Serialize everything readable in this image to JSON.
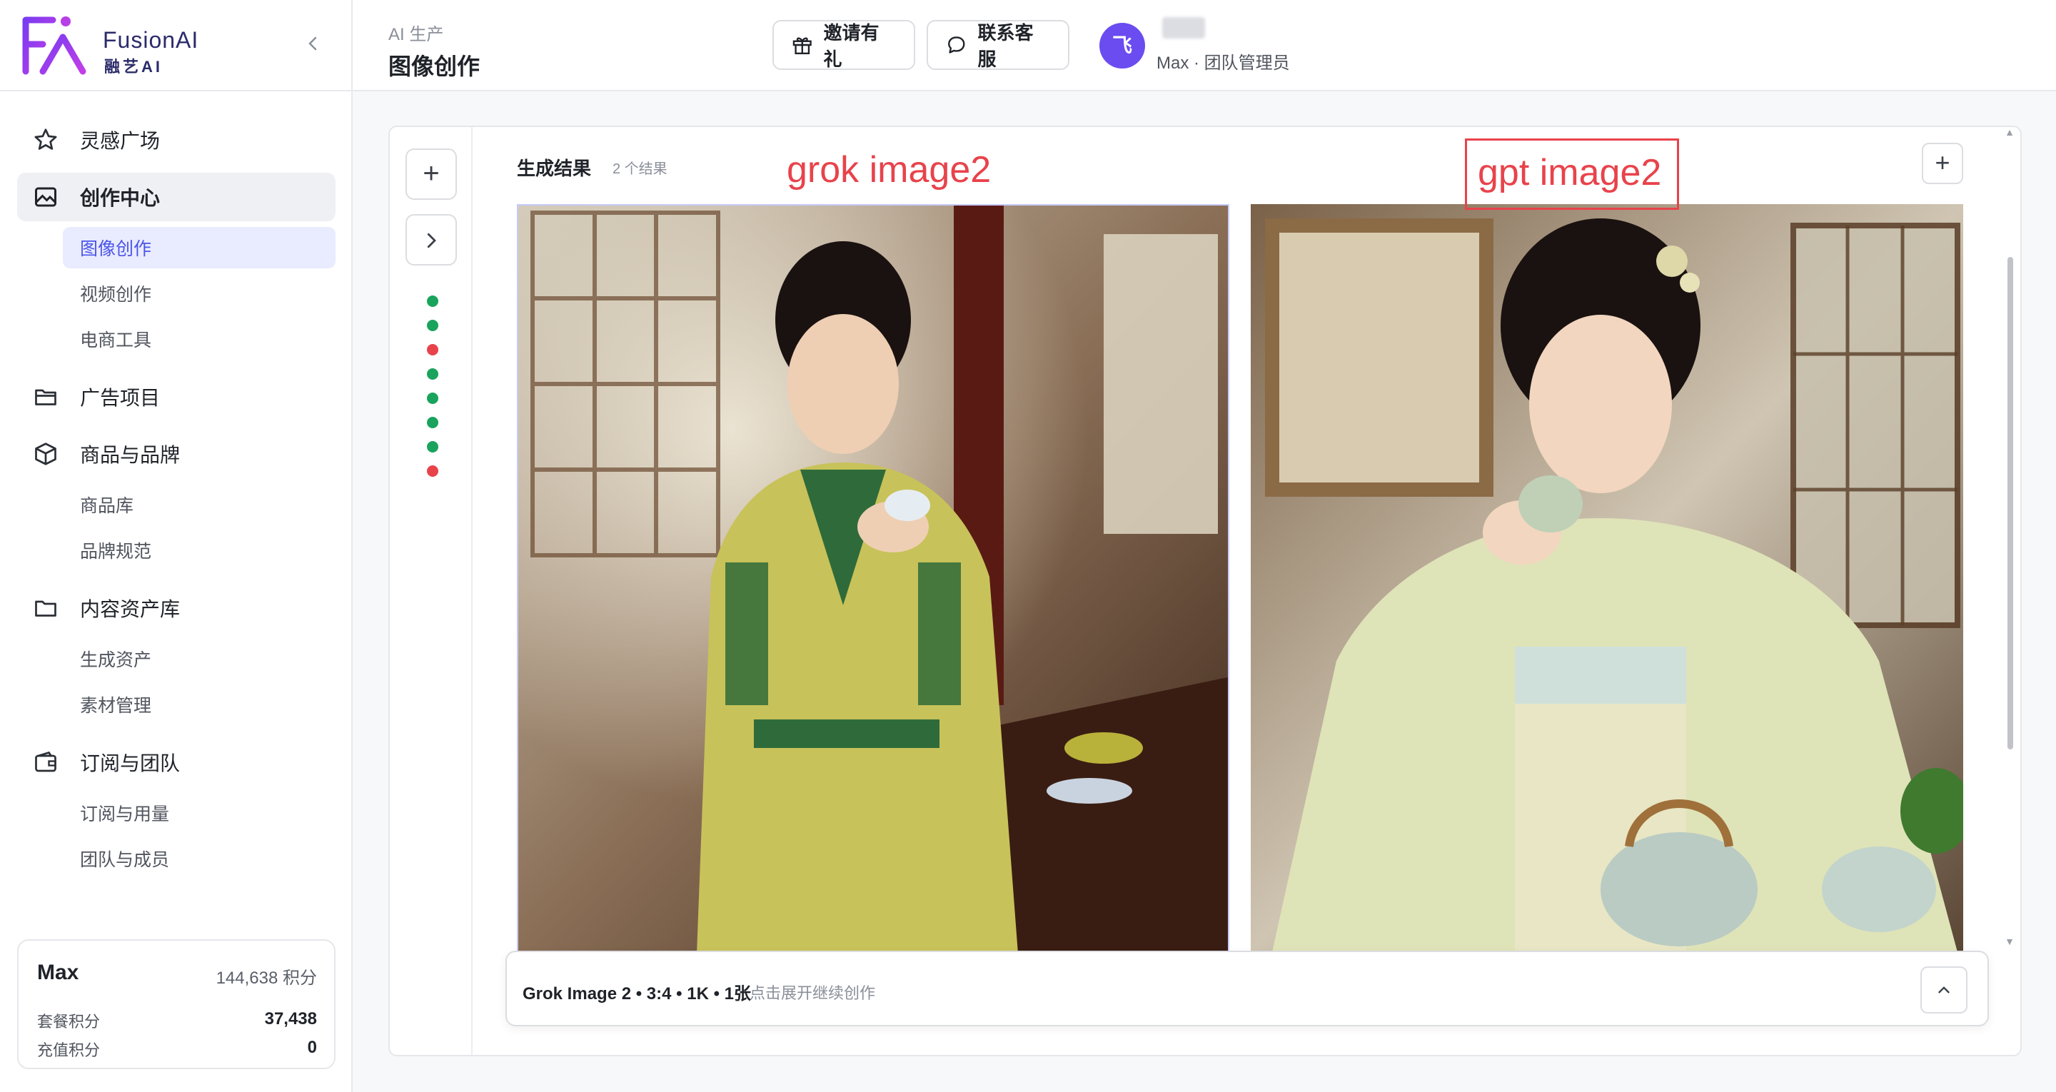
{
  "brand": {
    "name": "FusionAI",
    "subtitle": "融艺AI"
  },
  "colors": {
    "accent": "#4b55e8",
    "avatar": "#6a4cf0",
    "success": "#1aa35c",
    "error": "#e8434b",
    "annotation": "#e8434b"
  },
  "sidebar": {
    "items": [
      {
        "label": "灵感广场",
        "icon": "star-icon"
      },
      {
        "label": "创作中心",
        "icon": "image-icon",
        "active": true
      },
      {
        "label": "广告项目",
        "icon": "folder-open-icon"
      },
      {
        "label": "商品与品牌",
        "icon": "box-icon"
      },
      {
        "label": "内容资产库",
        "icon": "folder-icon"
      },
      {
        "label": "订阅与团队",
        "icon": "wallet-icon"
      }
    ],
    "sub": {
      "creation": [
        "图像创作",
        "视频创作",
        "电商工具"
      ],
      "products": [
        "商品库",
        "品牌规范"
      ],
      "assets": [
        "生成资产",
        "素材管理"
      ],
      "team": [
        "订阅与用量",
        "团队与成员"
      ]
    }
  },
  "credits": {
    "user": "Max",
    "total": "144,638 积分",
    "plan_label": "套餐积分",
    "plan_value": "37,438",
    "topup_label": "充值积分",
    "topup_value": "0"
  },
  "header": {
    "breadcrumb": "AI 生产",
    "title": "图像创作",
    "invite_label": "邀请有礼",
    "support_label": "联系客服",
    "avatar_text": "飞",
    "user_role": "Max · 团队管理员"
  },
  "toolbar": {
    "add_symbol": "+",
    "next_symbol": "›",
    "status_dots": [
      "success",
      "success",
      "error",
      "success",
      "success",
      "success",
      "success",
      "error"
    ]
  },
  "results": {
    "title": "生成结果",
    "count": "2 个结果",
    "add_symbol": "+",
    "annotation_left": "grok image2",
    "annotation_right": "gpt image2"
  },
  "composer": {
    "model_info": "Grok Image 2 • 3:4 • 1K • 1张",
    "hint": "点击展开继续创作"
  }
}
